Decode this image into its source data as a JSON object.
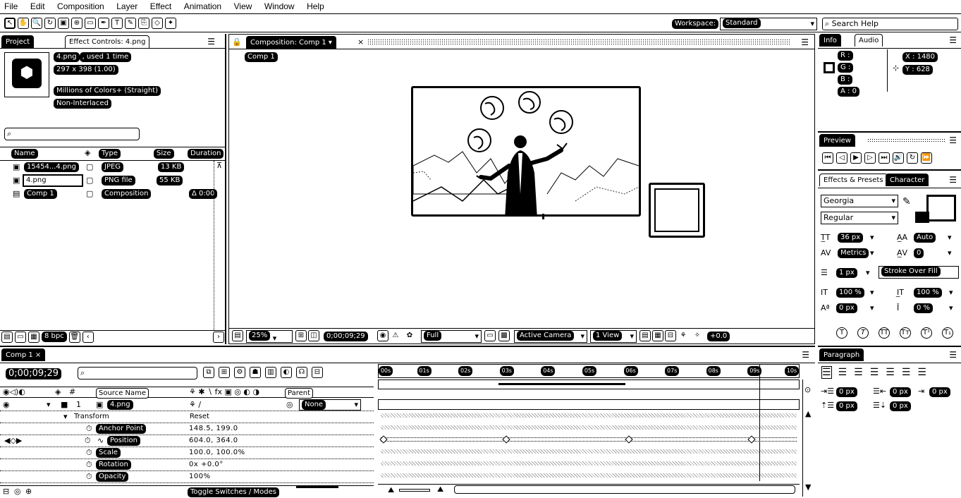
{
  "menu": [
    "File",
    "Edit",
    "Composition",
    "Layer",
    "Effect",
    "Animation",
    "View",
    "Window",
    "Help"
  ],
  "toolbar": {
    "workspace_label": "Workspace:",
    "workspace_value": "Standard",
    "search_placeholder": "Search Help"
  },
  "project_panel": {
    "tabs": [
      "Project",
      "Effect Controls: 4.png"
    ],
    "selected_name": "4.png",
    "used_label": ", used 1 time",
    "dimensions": "297 x 398 (1.00)",
    "color_info": "Millions of Colors+ (Straight)",
    "interlace": "Non-Interlaced",
    "columns": [
      "Name",
      "Type",
      "Size",
      "Duration"
    ],
    "items": [
      {
        "name": "15454...4.png",
        "type": "JPEG",
        "size": "13 KB",
        "duration": ""
      },
      {
        "name": "4.png",
        "type": "PNG file",
        "size": "55 KB",
        "duration": ""
      },
      {
        "name": "Comp 1",
        "type": "Composition",
        "size": "",
        "duration": "Δ 0:00"
      }
    ],
    "bpc": "8 bpc"
  },
  "composition_panel": {
    "tab": "Composition: Comp 1",
    "sub_tab": "Comp 1",
    "zoom": "25%",
    "timecode": "0;00;09;29",
    "resolution": "Full",
    "camera": "Active Camera",
    "views": "1 View",
    "exposure": "+0.0"
  },
  "info_panel": {
    "tabs": [
      "Info",
      "Audio"
    ],
    "channels": [
      "R :",
      "G :",
      "B :",
      "A : 0"
    ],
    "x": "X : 1480",
    "y": "Y : 628"
  },
  "preview_panel": {
    "tab": "Preview"
  },
  "character_panel": {
    "tabs": [
      "Effects & Presets",
      "Character"
    ],
    "font": "Georgia",
    "style": "Regular",
    "size": "36 px",
    "leading": "Auto",
    "kerning": "Metrics",
    "tracking": "0",
    "stroke_width": "1 px",
    "stroke_mode": "Stroke Over Fill",
    "vscale": "100 %",
    "hscale": "100 %",
    "baseline": "0 px",
    "tsume": "0 %"
  },
  "paragraph_panel": {
    "tab": "Paragraph",
    "indent_left": "0 px",
    "indent_right": "0 px",
    "indent_first": "0 px",
    "space_before": "0 px",
    "space_after": "0 px"
  },
  "timeline": {
    "tab": "Comp 1",
    "search_placeholder": "",
    "header_source": "Source Name",
    "header_parent": "Parent",
    "layer_num": "1",
    "layer_name": "4.png",
    "parent_value": "None",
    "transform_label": "Transform",
    "reset_label": "Reset",
    "properties": [
      {
        "name": "Anchor Point",
        "value": "148.5, 199.0"
      },
      {
        "name": "Position",
        "value": "604.0, 364.0"
      },
      {
        "name": "Scale",
        "value": "100.0, 100.0%"
      },
      {
        "name": "Rotation",
        "value": "0x +0.0°"
      },
      {
        "name": "Opacity",
        "value": "100%"
      }
    ],
    "toggle_label": "Toggle Switches / Modes",
    "ruler": [
      "00s",
      "01s",
      "02s",
      "03s",
      "04s",
      "05s",
      "06s",
      "07s",
      "08s",
      "09s",
      "10s"
    ],
    "keyframes_fraction": [
      0,
      0.3,
      0.6,
      0.9
    ],
    "playhead_fraction": 0.905
  },
  "colors": {
    "foreground": "#000000",
    "background": "#ffffff"
  }
}
